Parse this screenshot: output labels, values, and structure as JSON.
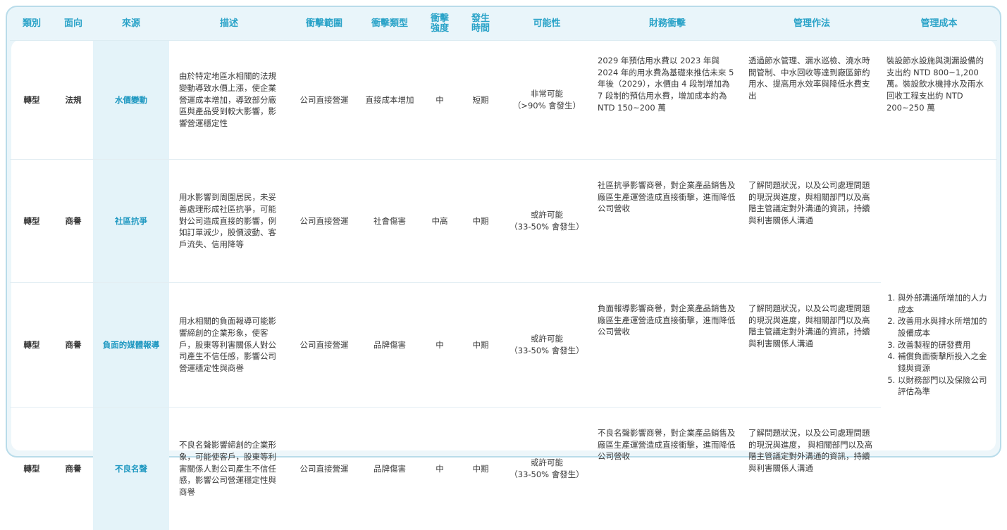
{
  "headers": {
    "category": "類別",
    "aspect": "面向",
    "source": "來源",
    "description": "描述",
    "impact_scope": "衝擊範圍",
    "impact_type": "衝擊類型",
    "impact_intensity": "衝擊\n強度",
    "occurrence_time": "發生\n時間",
    "likelihood": "可能性",
    "financial_impact": "財務衝擊",
    "management": "管理作法",
    "management_cost": "管理成本"
  },
  "rows": [
    {
      "category": "轉型",
      "aspect": "法規",
      "source": "水價變動",
      "description": "由於特定地區水相關的法規變動導致水價上漲，使企業營運成本增加，導致部分廠區與產品受到較大影響，影響營運穩定性",
      "impact_scope": "公司直接營運",
      "impact_type": "直接成本增加",
      "impact_intensity": "中",
      "occurrence_time": "短期",
      "likelihood": "非常可能\n（>90% 會發生）",
      "financial_impact": "2029 年預估用水費以 2023 年與 2024 年的用水費為基礎來推估未來 5 年後（2029），水價由 4 段制增加為 7 段制的預估用水費，增加成本約為 NTD 150~200 萬",
      "management": "透過節水管理、漏水巡檢、澆水時間管制、中水回收等達到廠區節約用水、提高用水效率與降低水費支出",
      "management_cost": "裝設節水設施與測漏設備的支出約 NTD 800~1,200 萬。裝設飲水機排水及雨水回收工程支出約 NTD 200~250 萬"
    },
    {
      "category": "轉型",
      "aspect": "商譽",
      "source": "社區抗爭",
      "description": "用水影響到周圍居民，未妥善處理形成社區抗爭，可能對公司造成直接的影響，例如訂單減少，股價波動、客戶流失、信用降等",
      "impact_scope": "公司直接營運",
      "impact_type": "社會傷害",
      "impact_intensity": "中高",
      "occurrence_time": "中期",
      "likelihood": "或許可能\n（33-50% 會發生）",
      "financial_impact": "社區抗爭影響商譽，對企業產品銷售及廠區生產運營造成直接衝擊，進而降低公司營收",
      "management": "了解問題狀況，以及公司處理問題的現況與進度，與相關部門以及高階主管議定對外溝通的資訊，持續與利害關係人溝通"
    },
    {
      "category": "轉型",
      "aspect": "商譽",
      "source": "負面的媒體報導",
      "description": "用水相關的負面報導可能影響締創的企業形象，使客戶，股東等利害關係人對公司產生不信任感，影響公司營運穩定性與商譽",
      "impact_scope": "公司直接營運",
      "impact_type": "品牌傷害",
      "impact_intensity": "中",
      "occurrence_time": "中期",
      "likelihood": "或許可能\n（33-50% 會發生）",
      "financial_impact": "負面報導影響商譽，對企業產品銷售及廠區生產運營造成直接衝擊，進而降低公司營收",
      "management": "了解問題狀況，以及公司處理問題的現況與進度，與相關部門以及高階主管議定對外溝通的資訊，持續與利害關係人溝通"
    },
    {
      "category": "轉型",
      "aspect": "商譽",
      "source": "不良名聲",
      "description": "不良名聲影響締創的企業形象，可能使客戶，股東等利害關係人對公司產生不信任感，影響公司營運穩定性與商譽",
      "impact_scope": "公司直接營運",
      "impact_type": "品牌傷害",
      "impact_intensity": "中",
      "occurrence_time": "中期",
      "likelihood": "或許可能\n（33-50% 會發生）",
      "financial_impact": "不良名聲影響商譽，對企業產品銷售及廠區生產運營造成直接衝擊，進而降低公司營收",
      "management": "了解問題狀況，以及公司處理問題的現況與進度， 與相關部門以及高階主管議定對外溝通的資訊，持續與利害關係人溝通"
    }
  ],
  "shared_management_cost": [
    "與外部溝通所增加的人力成本",
    "改善用水與排水所增加的設備成本",
    "改善製程的研發費用",
    "補償負面衝擊所投入之金錢與資源",
    "以財務部門以及保險公司評估為準"
  ],
  "colors": {
    "header_text": "#2aa3c8",
    "source_bg": "#e4f3f9",
    "source_text": "#1f98c1",
    "frame_border": "#b9dcea",
    "frame_bg": "#e9f5fa"
  }
}
